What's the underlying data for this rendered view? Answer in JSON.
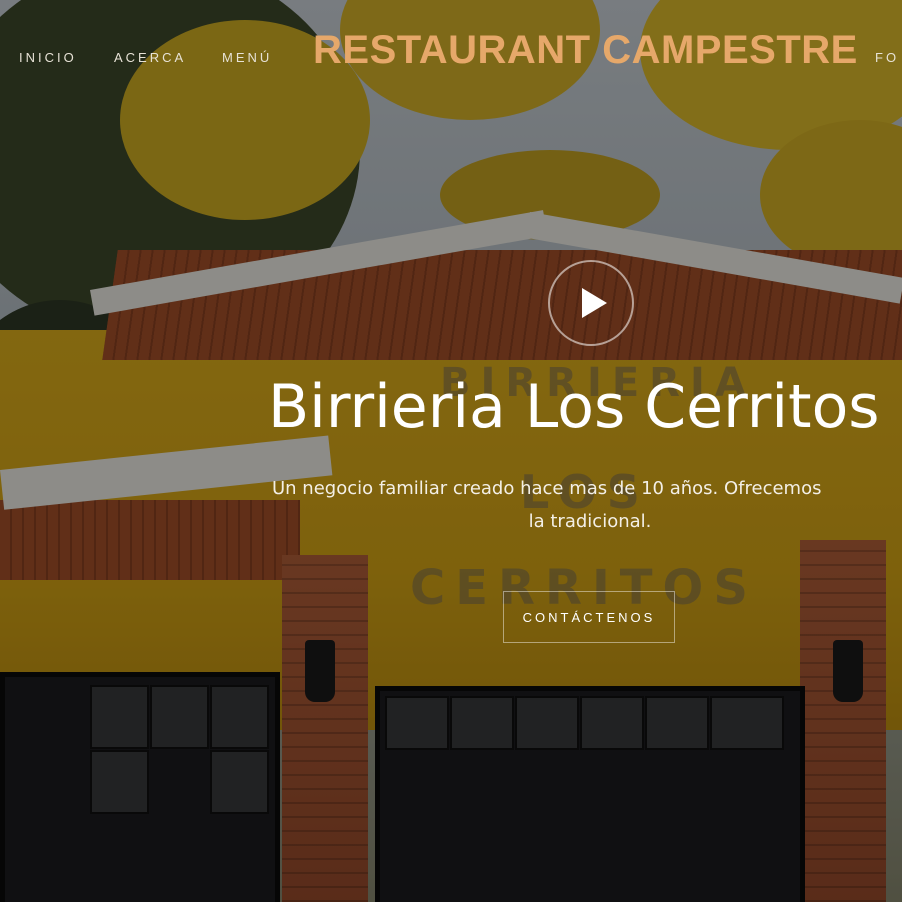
{
  "nav": {
    "items": [
      {
        "label": "INICIO"
      },
      {
        "label": "ACERCA"
      },
      {
        "label": "MENÚ"
      },
      {
        "label": "FO"
      }
    ],
    "brand": "RESTAURANT CAMPESTRE"
  },
  "hero": {
    "title": "Birrieria Los Cerritos",
    "description_line1": "Un negocio familiar creado hace mas de 10 años. Ofrecemos",
    "description_line2": "la tradicional.",
    "cta_label": "CONTÁCTENOS",
    "play_icon": "play-icon"
  },
  "scene": {
    "wall_sign_line1": "BIRRIERIA",
    "wall_sign_line2": "LOS",
    "wall_sign_line3": "CERRITOS"
  },
  "colors": {
    "brand": "#e6a86a",
    "nav_text": "#e7e2d6",
    "hero_text": "#ffffff",
    "wall_yellow": "#d9a816"
  }
}
